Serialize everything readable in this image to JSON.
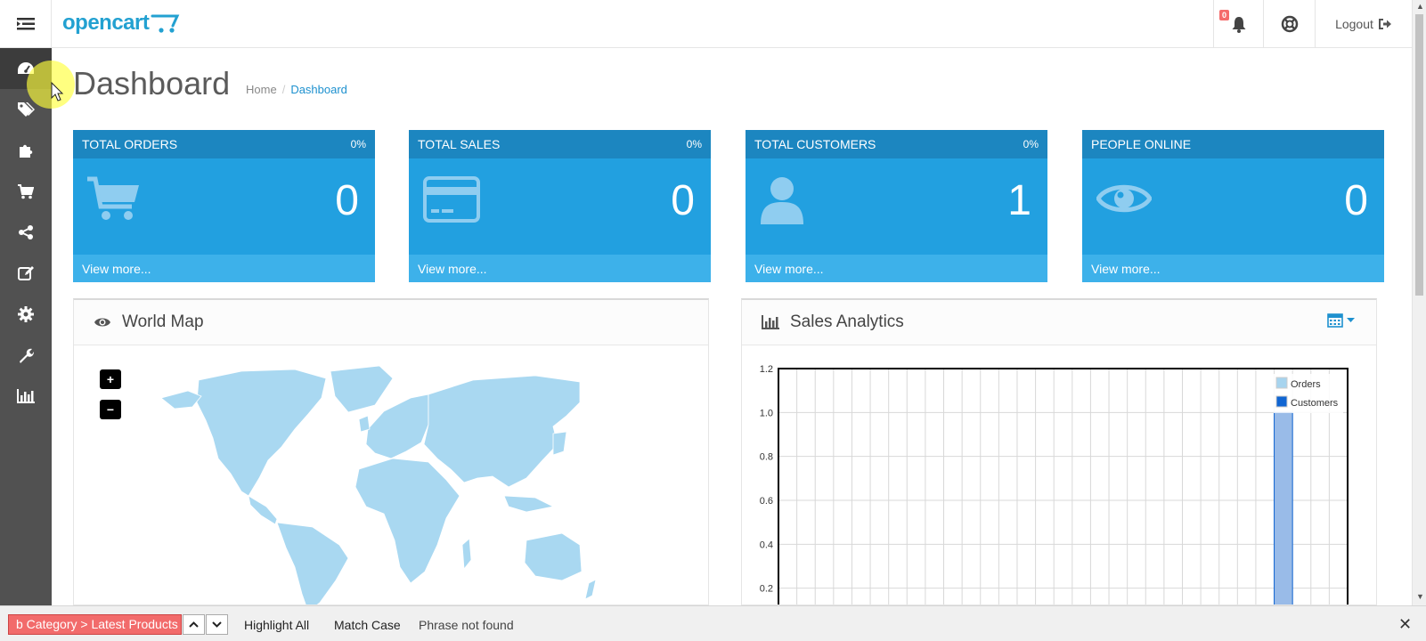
{
  "header": {
    "logo": "opencart",
    "notification_count": "0",
    "logout_label": "Logout"
  },
  "sidebar": {
    "items": [
      {
        "icon": "dashboard-icon",
        "active": true
      },
      {
        "icon": "tags-icon"
      },
      {
        "icon": "puzzle-icon"
      },
      {
        "icon": "cart-icon"
      },
      {
        "icon": "share-icon"
      },
      {
        "icon": "edit-icon"
      },
      {
        "icon": "gear-icon"
      },
      {
        "icon": "wrench-icon"
      },
      {
        "icon": "bar-chart-icon"
      }
    ]
  },
  "page": {
    "title": "Dashboard",
    "breadcrumb": [
      "Home",
      "Dashboard"
    ]
  },
  "tiles": [
    {
      "title": "TOTAL ORDERS",
      "pct": "0%",
      "value": "0",
      "link": "View more...",
      "icon": "cart-icon"
    },
    {
      "title": "TOTAL SALES",
      "pct": "0%",
      "value": "0",
      "link": "View more...",
      "icon": "credit-card-icon"
    },
    {
      "title": "TOTAL CUSTOMERS",
      "pct": "0%",
      "value": "1",
      "link": "View more...",
      "icon": "user-icon"
    },
    {
      "title": "PEOPLE ONLINE",
      "pct": "",
      "value": "0",
      "link": "View more...",
      "icon": "eye-icon"
    }
  ],
  "world_map": {
    "title": "World Map",
    "zoom_in": "+",
    "zoom_out": "−"
  },
  "sales": {
    "title": "Sales Analytics"
  },
  "chart_data": {
    "type": "bar",
    "ylim": [
      0,
      1.2
    ],
    "yticks": [
      "1.2",
      "1.0",
      "0.8",
      "0.6",
      "0.4",
      "0.2"
    ],
    "grid": true,
    "legend_position": "top-right",
    "series": [
      {
        "name": "Orders",
        "color": "#a7d4ee",
        "values": [
          0
        ]
      },
      {
        "name": "Customers",
        "color": "#1065d2",
        "values": [
          1
        ]
      }
    ],
    "bar_color": "#99bbe8",
    "bar_value": 1.0
  },
  "findbar": {
    "query": "b Category > Latest Products",
    "highlight_all": "Highlight All",
    "match_case": "Match Case",
    "status": "Phrase not found",
    "close": "✕"
  },
  "colors": {
    "accent": "#1e91cf",
    "sidebar": "#515151"
  }
}
